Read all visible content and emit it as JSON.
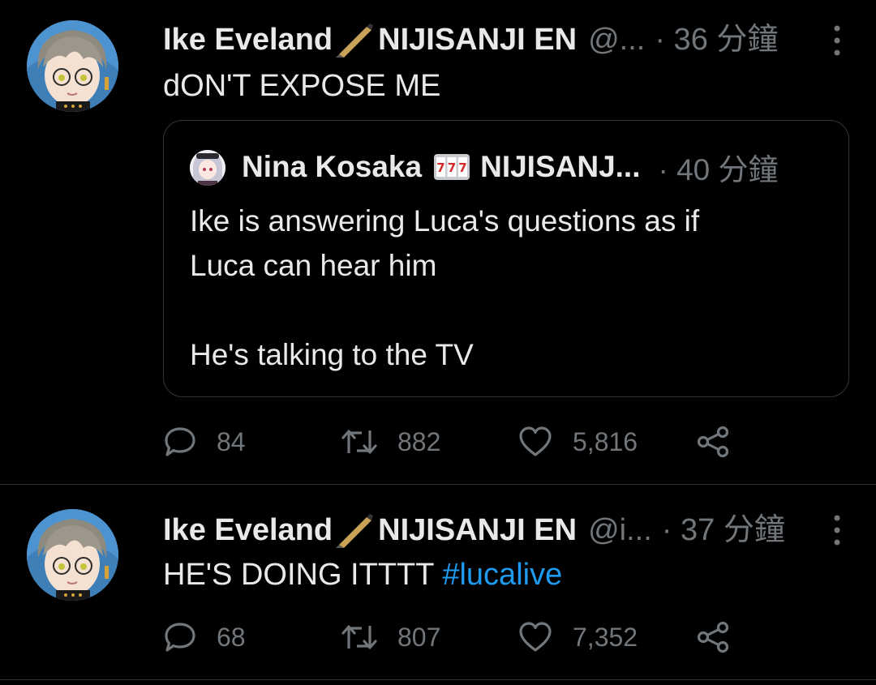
{
  "tweets": [
    {
      "display_name": "Ike Eveland",
      "org": "NIJISANJI EN",
      "handle": "@...",
      "time": "· 36 分鐘",
      "text": "dON'T EXPOSE ME",
      "quote": {
        "display_name": "Nina Kosaka",
        "org": "NIJISANJ...",
        "time": "· 40 分鐘",
        "lines": [
          "Ike is answering Luca's questions as if",
          "Luca can hear him",
          "",
          "He's talking to the TV"
        ]
      },
      "replies": "84",
      "retweets": "882",
      "likes": "5,816"
    },
    {
      "display_name": "Ike Eveland",
      "org": "NIJISANJI EN",
      "handle": "@i...",
      "time": "· 37 分鐘",
      "text": "HE'S DOING ITTTT",
      "hashtag": "#lucalive",
      "replies": "68",
      "retweets": "807",
      "likes": "7,352"
    }
  ],
  "icons": {
    "name_emoji": "fountain-pen-icon",
    "quote_emoji": "slot-machine-icon",
    "more": "more-vertical-icon",
    "reply": "reply-icon",
    "retweet": "retweet-icon",
    "like": "heart-icon",
    "share": "share-icon"
  },
  "colors": {
    "background": "#000000",
    "text": "#e7e9ea",
    "secondary": "#71767b",
    "hashtag": "#1d9bf0",
    "divider": "#2f3336"
  }
}
